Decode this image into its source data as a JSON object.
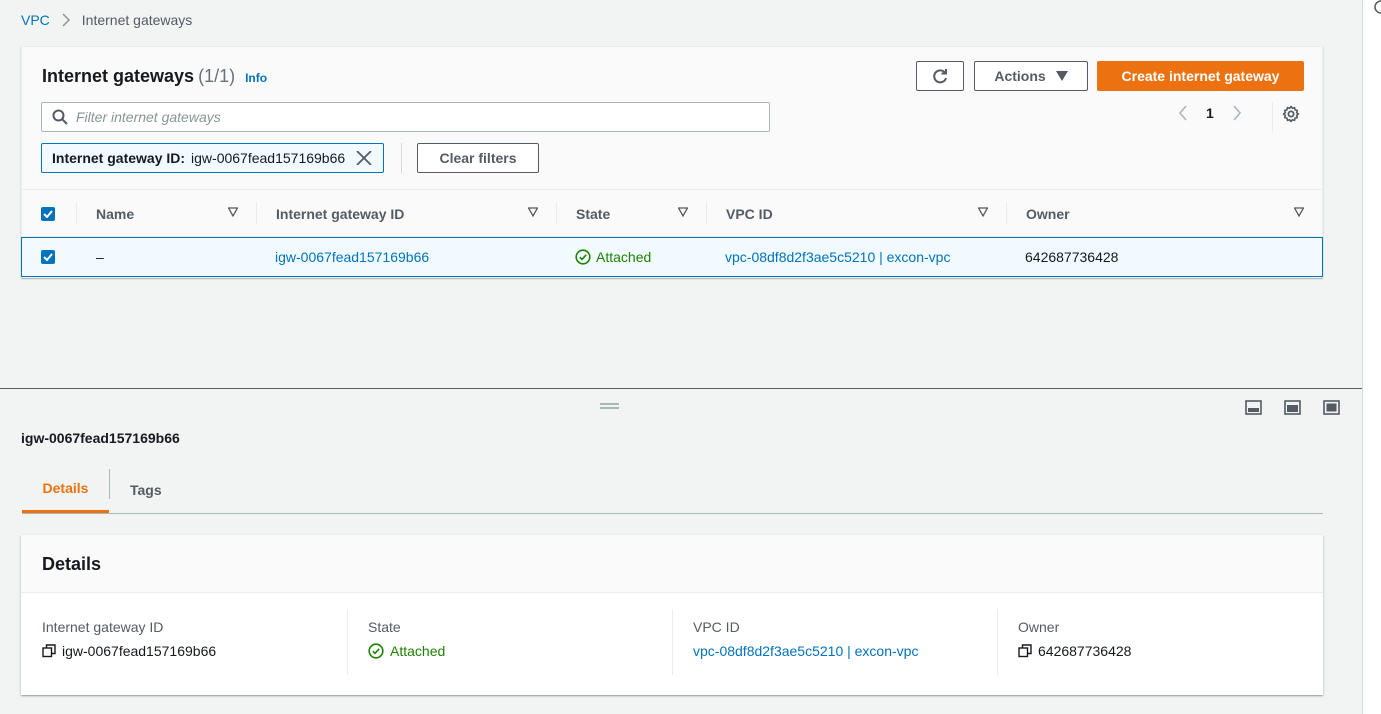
{
  "breadcrumb": {
    "root": "VPC",
    "current": "Internet gateways"
  },
  "list": {
    "title": "Internet gateways",
    "count": "(1/1)",
    "info": "Info",
    "actions_label": "Actions",
    "create_label": "Create internet gateway",
    "search_placeholder": "Filter internet gateways",
    "page_number": "1",
    "filter_token": {
      "key": "Internet gateway ID:",
      "value": "igw-0067fead157169b66"
    },
    "clear_filters": "Clear filters",
    "columns": [
      "Name",
      "Internet gateway ID",
      "State",
      "VPC ID",
      "Owner"
    ],
    "rows": [
      {
        "name": "–",
        "id": "igw-0067fead157169b66",
        "state": "Attached",
        "vpc": "vpc-08df8d2f3ae5c5210 | excon-vpc",
        "owner": "642687736428"
      }
    ]
  },
  "detail": {
    "title": "igw-0067fead157169b66",
    "tabs": [
      "Details",
      "Tags"
    ],
    "card_title": "Details",
    "fields": [
      {
        "label": "Internet gateway ID",
        "value": "igw-0067fead157169b66"
      },
      {
        "label": "State",
        "value": "Attached"
      },
      {
        "label": "VPC ID",
        "value": "vpc-08df8d2f3ae5c5210 | excon-vpc"
      },
      {
        "label": "Owner",
        "value": "642687736428"
      }
    ]
  },
  "colors": {
    "accent": "#ec7211",
    "link": "#0073bb",
    "success": "#1d8102",
    "selected_bg": "#f1faff"
  }
}
